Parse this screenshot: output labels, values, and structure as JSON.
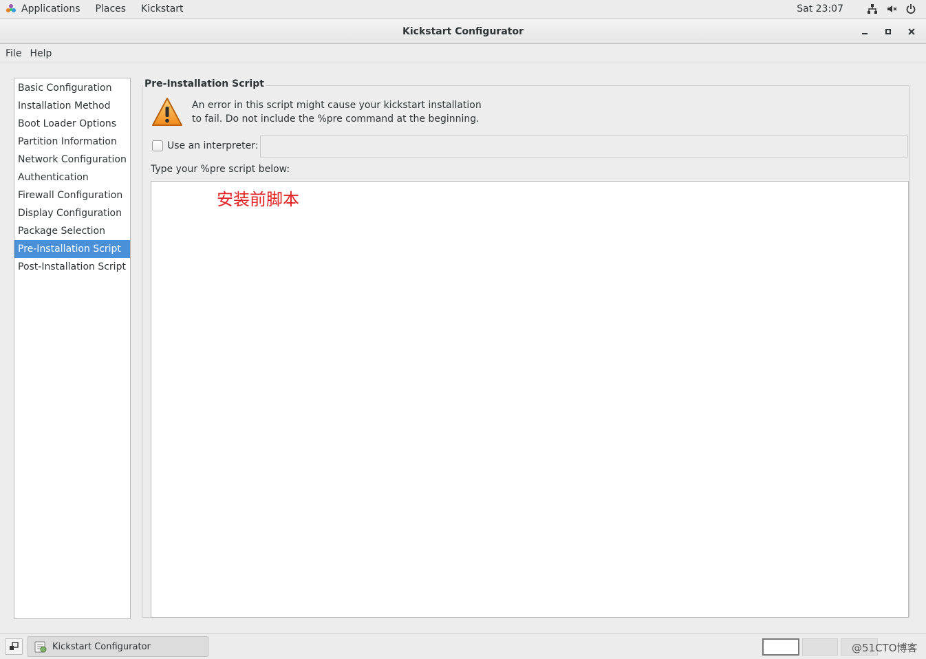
{
  "top_panel": {
    "menus": [
      "Applications",
      "Places",
      "Kickstart"
    ],
    "clock": "Sat 23:07"
  },
  "window": {
    "title": "Kickstart Configurator"
  },
  "menubar": {
    "items": [
      "File",
      "Help"
    ]
  },
  "sidebar": {
    "items": [
      "Basic Configuration",
      "Installation Method",
      "Boot Loader Options",
      "Partition Information",
      "Network Configuration",
      "Authentication",
      "Firewall Configuration",
      "Display Configuration",
      "Package Selection",
      "Pre-Installation Script",
      "Post-Installation Script"
    ],
    "selected": "Pre-Installation Script"
  },
  "panel": {
    "frame_label": "Pre-Installation Script",
    "warning_line1": "An error in this script might cause your kickstart installation",
    "warning_line2": "to fail. Do not include the %pre command at the beginning.",
    "interpreter_label": "Use an interpreter:",
    "interpreter_checked": false,
    "interpreter_value": "",
    "script_label": "Type your %pre script below:",
    "script_value": "",
    "annotation": "安装前脚本"
  },
  "taskbar": {
    "task_label": "Kickstart Configurator",
    "watermark": "@51CTO博客"
  },
  "colors": {
    "selection": "#4a90d9",
    "annotation": "#e02020",
    "warning": "#f0a030"
  }
}
